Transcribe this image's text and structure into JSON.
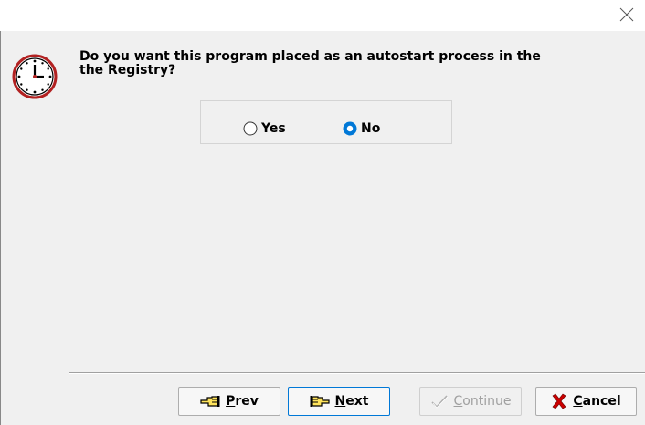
{
  "question": {
    "line1": "Do you want this program placed as an autostart process in the",
    "line2": "the Registry?"
  },
  "options": {
    "yes_label": "Yes",
    "no_label": "No",
    "selected": "No"
  },
  "buttons": {
    "prev_label_first": "P",
    "prev_label_rest": "rev",
    "next_label_first": "N",
    "next_label_rest": "ext",
    "continue_label_first": "C",
    "continue_label_rest": "ontinue",
    "cancel_label_first": "C",
    "cancel_label_rest": "ancel"
  },
  "colors": {
    "accent": "#0078d7",
    "cancel_x": "#cc0000",
    "clock_rim": "#b22222"
  },
  "icons": [
    "close-icon",
    "clock-icon",
    "hand-left-icon",
    "hand-right-icon",
    "check-icon",
    "x-icon"
  ]
}
